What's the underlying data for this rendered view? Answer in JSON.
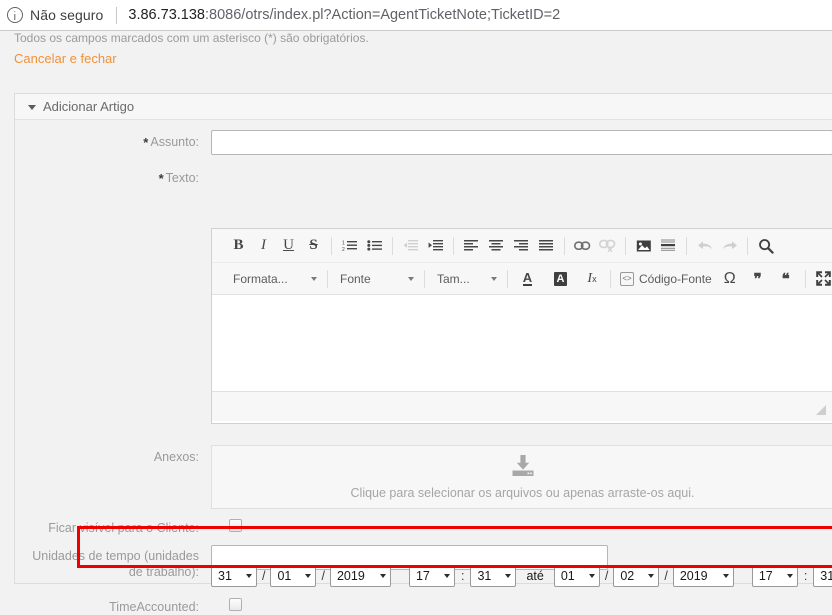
{
  "browser": {
    "security_label": "Não seguro",
    "url_host": "3.86.73.138",
    "url_rest": ":8086/otrs/index.pl?Action=AgentTicketNote;TicketID=2"
  },
  "page": {
    "mandatory_note": "Todos os campos marcados com um asterisco (*) são obrigatórios.",
    "cancel_link": "Cancelar e fechar"
  },
  "widget": {
    "title": "Adicionar Artigo"
  },
  "form": {
    "subject": {
      "label": "Assunto:",
      "required_mark": "*",
      "value": ""
    },
    "text": {
      "label": "Texto:",
      "required_mark": "*"
    },
    "attachments": {
      "label": "Anexos:",
      "dropzone_text": "Clique para selecionar os arquivos ou apenas arraste-os aqui.",
      "icon": "download-tray-icon"
    },
    "visible_to_customer": {
      "label": "Ficar visível para o Cliente:",
      "checked": false
    },
    "time_units": {
      "label_line1": "Unidades de tempo (unidades",
      "label_line2": "de trabalho):",
      "value": ""
    },
    "time_accounted": {
      "label": "TimeAccounted:",
      "checked": false,
      "start": {
        "day": "31",
        "month": "01",
        "year": "2019",
        "hour": "17",
        "minute": "31"
      },
      "separator": "até",
      "end": {
        "day": "01",
        "month": "02",
        "year": "2019",
        "hour": "17",
        "minute": "31"
      },
      "date_sep": "/",
      "time_sep": ":"
    }
  },
  "editor": {
    "toolbar_row1": [
      {
        "name": "bold-icon",
        "glyph": "B",
        "style": "bold",
        "disabled": false
      },
      {
        "name": "italic-icon",
        "glyph": "I",
        "style": "italic",
        "disabled": false
      },
      {
        "name": "underline-icon",
        "glyph": "U",
        "style": "underline",
        "disabled": false
      },
      {
        "name": "strikethrough-icon",
        "glyph": "S",
        "style": "strike",
        "disabled": false
      },
      {
        "name": "separator",
        "glyph": "",
        "style": "sep",
        "disabled": false
      },
      {
        "name": "numbered-list-icon",
        "glyph": "ol",
        "style": "svg",
        "disabled": false
      },
      {
        "name": "bulleted-list-icon",
        "glyph": "ul",
        "style": "svg",
        "disabled": false
      },
      {
        "name": "separator",
        "glyph": "",
        "style": "sep",
        "disabled": false
      },
      {
        "name": "decrease-indent-icon",
        "glyph": "outdent",
        "style": "svg",
        "disabled": true
      },
      {
        "name": "increase-indent-icon",
        "glyph": "indent",
        "style": "svg",
        "disabled": false
      },
      {
        "name": "separator",
        "glyph": "",
        "style": "sep",
        "disabled": false
      },
      {
        "name": "align-left-icon",
        "glyph": "alignleft",
        "style": "svg",
        "disabled": false
      },
      {
        "name": "align-center-icon",
        "glyph": "aligncenter",
        "style": "svg",
        "disabled": false
      },
      {
        "name": "align-right-icon",
        "glyph": "alignright",
        "style": "svg",
        "disabled": false
      },
      {
        "name": "align-justify-icon",
        "glyph": "alignjustify",
        "style": "svg",
        "disabled": false
      },
      {
        "name": "separator",
        "glyph": "",
        "style": "sep",
        "disabled": false
      },
      {
        "name": "link-icon",
        "glyph": "link",
        "style": "svg",
        "disabled": false
      },
      {
        "name": "unlink-icon",
        "glyph": "unlink",
        "style": "svg",
        "disabled": true
      },
      {
        "name": "separator",
        "glyph": "",
        "style": "sep",
        "disabled": false
      },
      {
        "name": "image-icon",
        "glyph": "image",
        "style": "svg",
        "disabled": false
      },
      {
        "name": "horizontal-rule-icon",
        "glyph": "hr",
        "style": "svg",
        "disabled": false
      },
      {
        "name": "separator",
        "glyph": "",
        "style": "sep",
        "disabled": false
      },
      {
        "name": "undo-icon",
        "glyph": "undo",
        "style": "svg",
        "disabled": true
      },
      {
        "name": "redo-icon",
        "glyph": "redo",
        "style": "svg",
        "disabled": true
      },
      {
        "name": "separator",
        "glyph": "",
        "style": "sep",
        "disabled": false
      },
      {
        "name": "search-icon",
        "glyph": "search",
        "style": "svg",
        "disabled": false
      }
    ],
    "combo_format": "Formata...",
    "combo_font": "Fonte",
    "combo_size": "Tam...",
    "text_color_label": "A",
    "bg_color_label": "A",
    "remove_format_label": "Ix",
    "source_label": "Código-Fonte",
    "omega_label": "Ω",
    "quote_open_label": "❞",
    "quote_close_label": "❝",
    "maximize_label": "maximize-icon"
  },
  "colors": {
    "accent_link": "#f39139",
    "highlight_box": "#ee0000",
    "label_gray": "#9a9a9a",
    "page_bg": "#f2f2f2"
  }
}
